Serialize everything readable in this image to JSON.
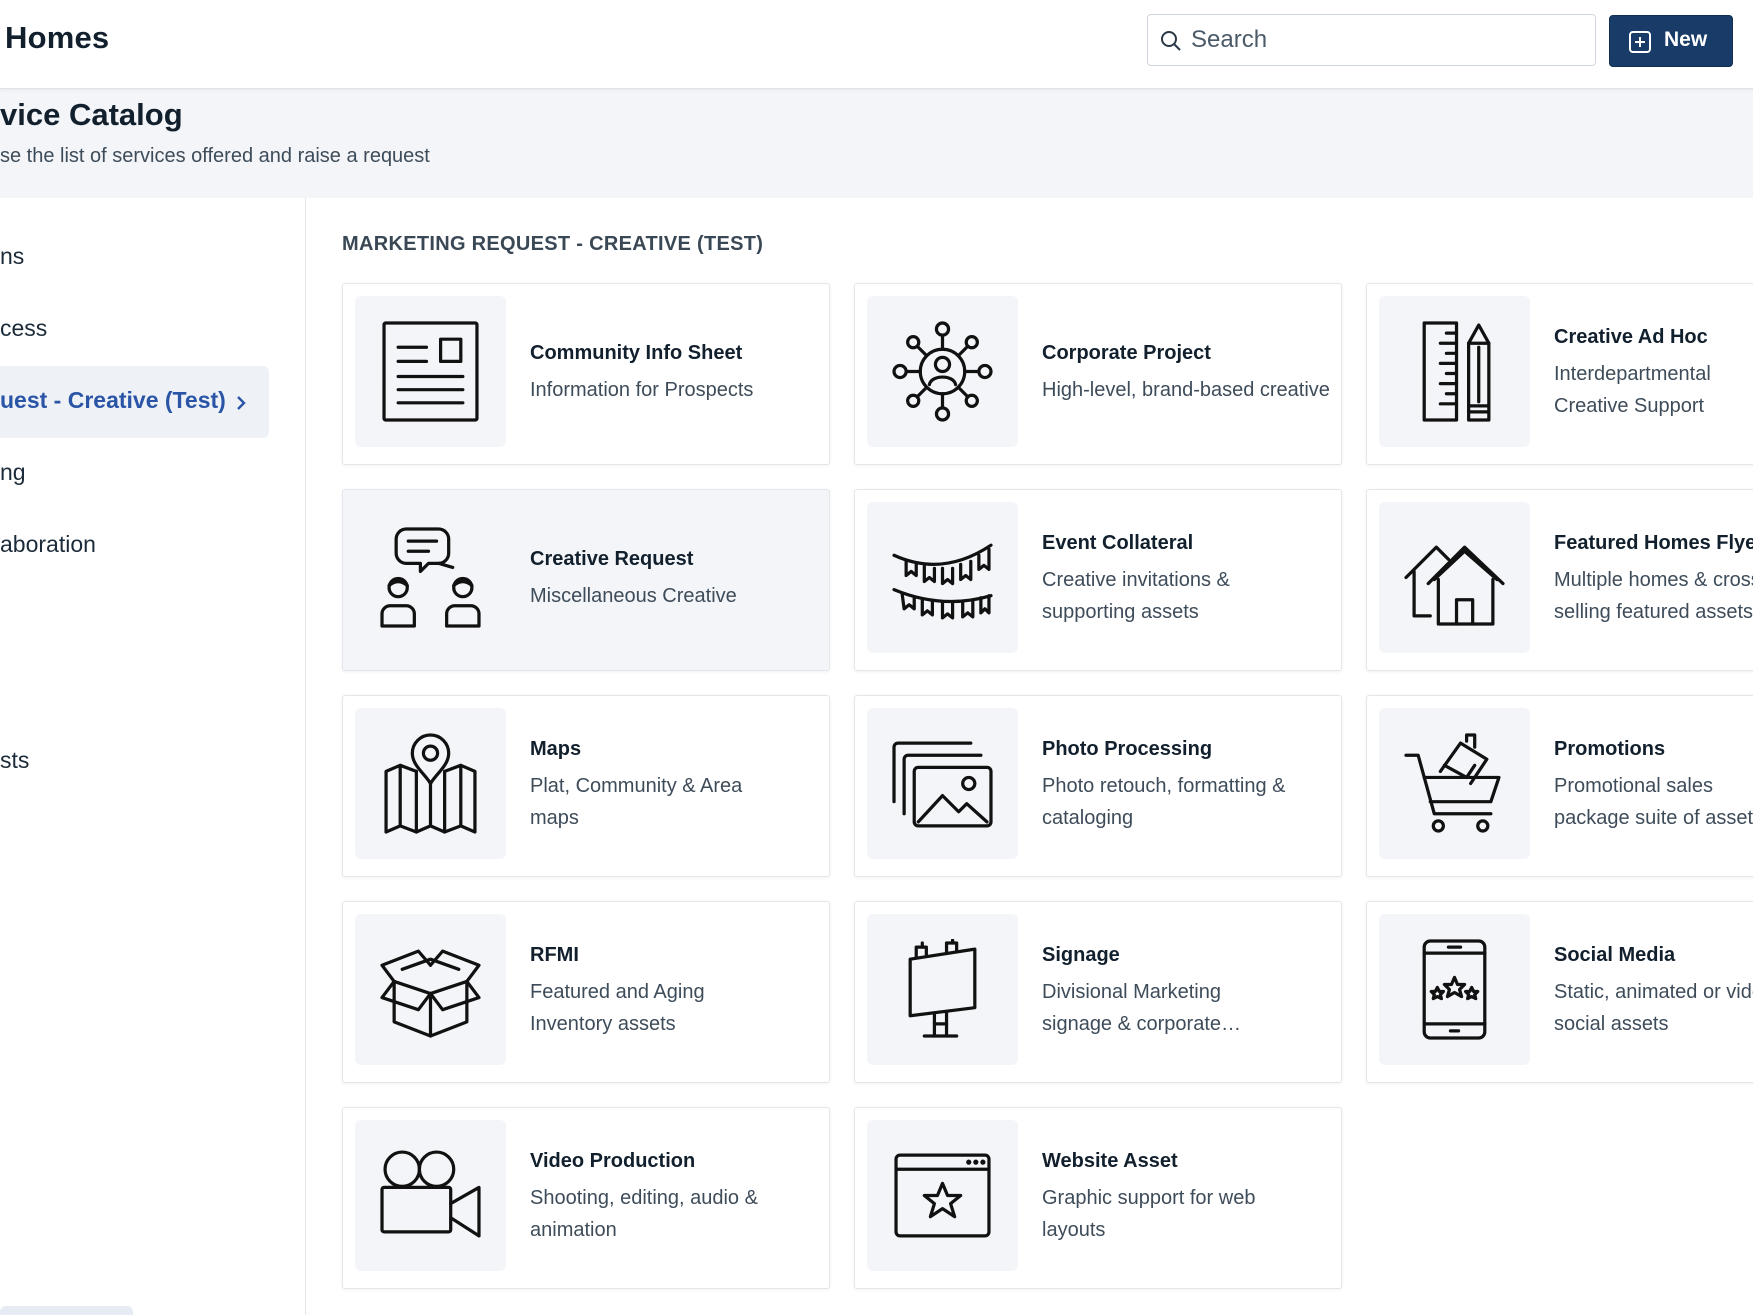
{
  "app": {
    "title": "Homes"
  },
  "search": {
    "placeholder": "Search"
  },
  "toolbar": {
    "new_label": "New"
  },
  "page": {
    "title": "vice Catalog",
    "subtitle": "se the list of services offered and raise a request"
  },
  "sidebar": {
    "items": [
      {
        "label": "ns"
      },
      {
        "label": "cess"
      },
      {
        "label": "uest - Creative (Test)",
        "active": true
      },
      {
        "label": "ng"
      },
      {
        "label": "aboration"
      },
      {
        "label": "sts"
      }
    ]
  },
  "section": {
    "title": "MARKETING REQUEST - CREATIVE (TEST)"
  },
  "cards": [
    {
      "title": "Community Info Sheet",
      "desc": "Information for Prospects",
      "icon": "document-icon"
    },
    {
      "title": "Corporate Project",
      "desc": "High-level, brand-based creative",
      "icon": "network-person-icon"
    },
    {
      "title": "Creative Ad Hoc",
      "desc": "Interdepartmental Creative Support",
      "icon": "ruler-pencil-icon"
    },
    {
      "title": "Creative Request",
      "desc": "Miscellaneous Creative",
      "icon": "chat-people-icon"
    },
    {
      "title": "Event Collateral",
      "desc": "Creative invitations & supporting assets",
      "icon": "bunting-icon"
    },
    {
      "title": "Featured Homes Flyer",
      "desc": "Multiple homes & cross selling featured assets",
      "icon": "houses-icon"
    },
    {
      "title": "Maps",
      "desc": "Plat, Community & Area maps",
      "icon": "map-pin-icon"
    },
    {
      "title": "Photo Processing",
      "desc": "Photo retouch, formatting & cataloging",
      "icon": "photos-icon"
    },
    {
      "title": "Promotions",
      "desc": "Promotional sales package suite of assets",
      "icon": "cart-house-icon"
    },
    {
      "title": "RFMI",
      "desc": "Featured and Aging Inventory assets",
      "icon": "box-icon"
    },
    {
      "title": "Signage",
      "desc": "Divisional Marketing signage & corporate…",
      "icon": "billboard-icon"
    },
    {
      "title": "Social Media",
      "desc": "Static, animated or video social assets",
      "icon": "phone-stars-icon"
    },
    {
      "title": "Video Production",
      "desc": "Shooting, editing, audio & animation",
      "icon": "video-camera-icon"
    },
    {
      "title": "Website Asset",
      "desc": "Graphic support for web layouts",
      "icon": "browser-star-icon"
    }
  ],
  "colors": {
    "accent": "#183b67",
    "active_link": "#2a55a6",
    "header_bg": "#f3f5f8"
  }
}
